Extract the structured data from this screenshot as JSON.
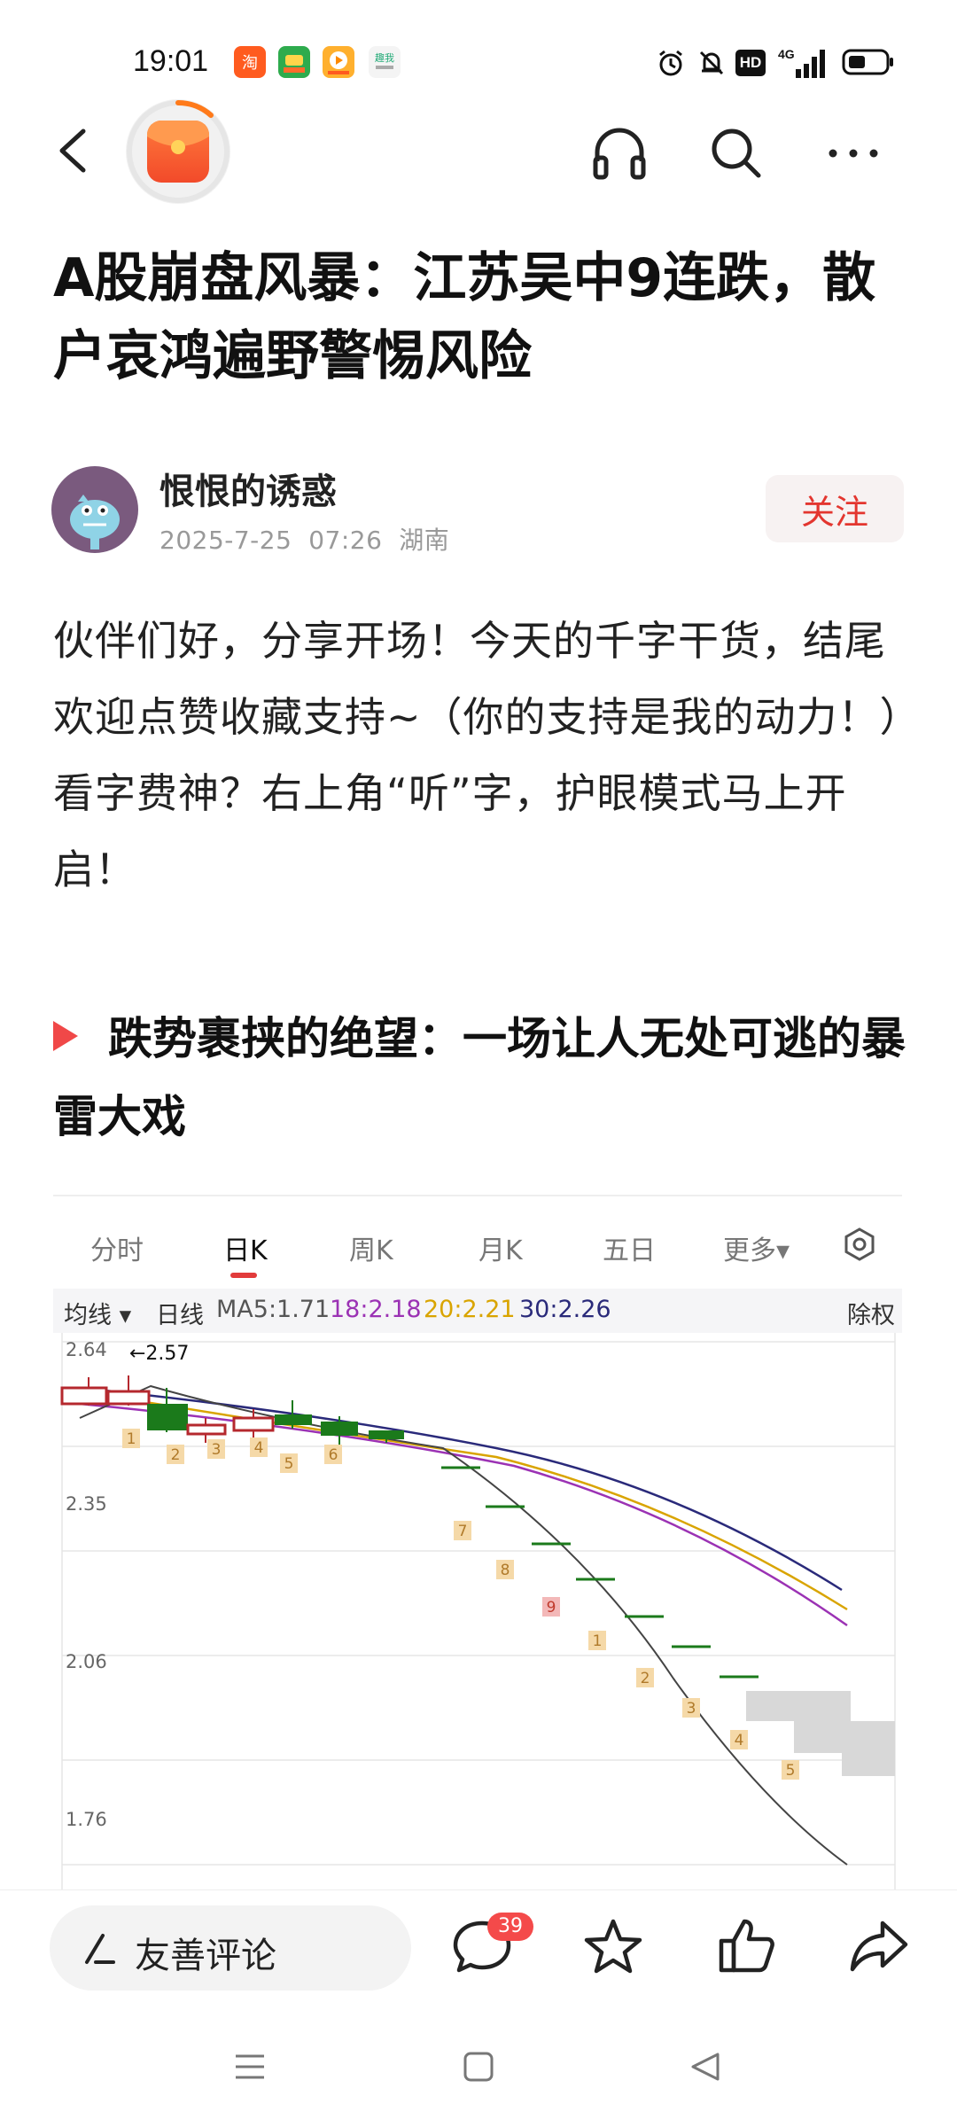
{
  "status_bar": {
    "time": "19:01",
    "app_icons": [
      "taobao-icon",
      "game-app-icon",
      "video-app-icon",
      "news-app-icon"
    ],
    "right_icons": [
      "alarm-icon",
      "mute-icon",
      "hd-icon",
      "4g-signal-icon",
      "battery-icon"
    ],
    "network": "4G"
  },
  "header": {
    "back_icon": "back-icon",
    "red_packet_icon": "red-packet-icon",
    "actions": [
      "headphones-icon",
      "search-icon",
      "more-icon"
    ]
  },
  "article": {
    "title": "A股崩盘风暴：江苏吴中9连跌，散户哀鸿遍野警惕风险",
    "author": {
      "name": "恨恨的诱惑",
      "date": "2025-7-25",
      "time": "07:26",
      "location": "湖南"
    },
    "follow_label": "关注",
    "intro": "伙伴们好，分享开场！今天的千字干货，结尾欢迎点赞收藏支持~（你的支持是我的动力！）看字费神？右上角“听”字，护眼模式马上开启！",
    "section_title": "跌势裹挟的绝望：一场让人无处可逃的暴雷大戏"
  },
  "chart_image": {
    "tabs": [
      "分时",
      "日K",
      "周K",
      "月K",
      "五日",
      "更多▾"
    ],
    "active_tab": "日K",
    "settings_icon": "hexagon-settings-icon",
    "ma_row": {
      "selector": "均线 ▾",
      "period": "日线",
      "ma5": "MA5:1.71",
      "ma18": "18:2.18",
      "ma20": "20:2.21",
      "ma30": "30:2.26",
      "adjust": "除权"
    },
    "colors": {
      "ma5": "#555555",
      "ma18": "#9b32b4",
      "ma20": "#d9a400",
      "ma30": "#2a2a7a",
      "up": "#b5282e",
      "down": "#1b7a1b",
      "marker": "#f5d9a8",
      "marker_hot": "#f3b8b8"
    },
    "high_label": "←2.57",
    "y_ticks": [
      "2.64",
      "2.35",
      "2.06",
      "1.76"
    ],
    "day_labels": [
      "1",
      "2",
      "3",
      "4",
      "5",
      "6",
      "7",
      "8",
      "9",
      "1",
      "2",
      "3",
      "4",
      "5"
    ]
  },
  "bottom_bar": {
    "comment_icon": "pen-icon",
    "comment_placeholder": "友善评论",
    "comment_count": "39",
    "actions": [
      "comment-icon",
      "star-icon",
      "like-icon",
      "share-icon"
    ]
  },
  "nav_bar": [
    "menu-icon",
    "home-icon",
    "back-triangle-icon"
  ]
}
